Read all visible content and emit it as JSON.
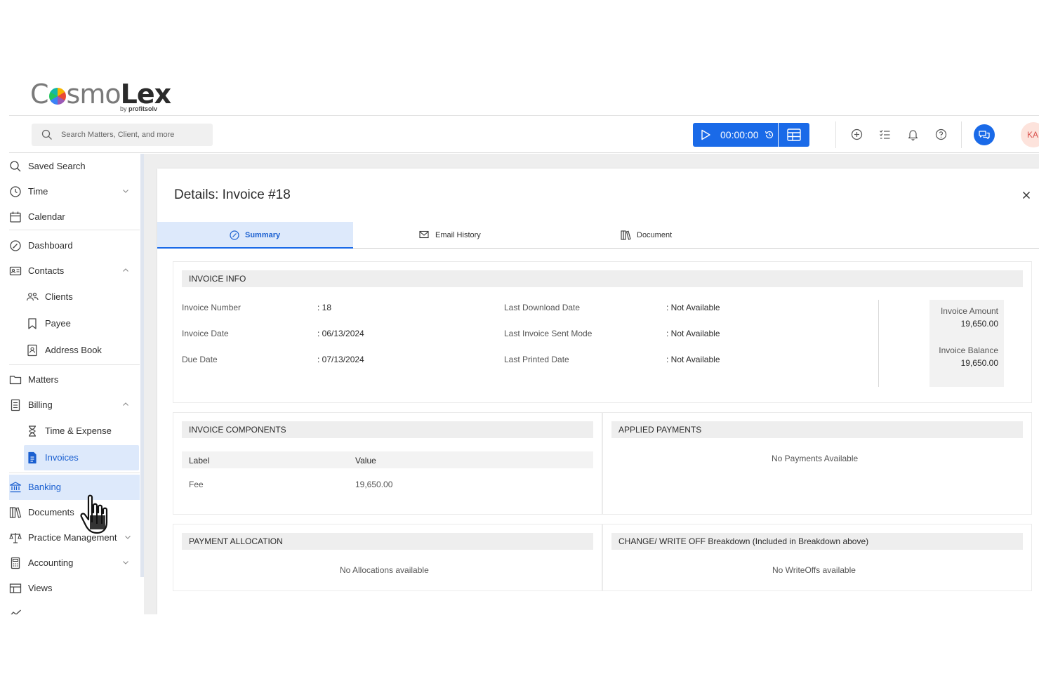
{
  "brand": {
    "logo_pre": "C",
    "logo_mid": "smo",
    "logo_bold": "Lex",
    "logo_sub_by": "by",
    "logo_sub_name": "profitsolv"
  },
  "topbar": {
    "search_placeholder": "Search Matters, Client, and more",
    "timer_value": "00:00:00",
    "avatar_initials": "KA"
  },
  "sidebar": {
    "saved_search": "Saved Search",
    "time": "Time",
    "calendar": "Calendar",
    "dashboard": "Dashboard",
    "contacts": "Contacts",
    "clients": "Clients",
    "payee": "Payee",
    "address_book": "Address Book",
    "matters": "Matters",
    "billing": "Billing",
    "time_expense": "Time & Expense",
    "invoices": "Invoices",
    "banking": "Banking",
    "documents": "Documents",
    "practice_management": "Practice Management",
    "accounting": "Accounting",
    "views": "Views"
  },
  "dialog": {
    "title": "Details: Invoice #18",
    "tabs": {
      "summary": "Summary",
      "email_history": "Email History",
      "document": "Document"
    },
    "invoice_info": {
      "header": "INVOICE INFO",
      "invoice_number_label": "Invoice Number",
      "invoice_number_value": ": 18",
      "invoice_date_label": "Invoice Date",
      "invoice_date_value": ": 06/13/2024",
      "due_date_label": "Due Date",
      "due_date_value": ": 07/13/2024",
      "last_download_label": "Last Download Date",
      "last_download_value": ": Not Available",
      "last_sent_mode_label": "Last Invoice Sent Mode",
      "last_sent_mode_value": ": Not Available",
      "last_printed_label": "Last Printed Date",
      "last_printed_value": ": Not Available",
      "invoice_amount_label": "Invoice Amount",
      "invoice_amount_value": "19,650.00",
      "invoice_balance_label": "Invoice Balance",
      "invoice_balance_value": "19,650.00"
    },
    "invoice_components": {
      "header": "INVOICE COMPONENTS",
      "col_label": "Label",
      "col_value": "Value",
      "rows": [
        {
          "label": "Fee",
          "value": "19,650.00"
        }
      ]
    },
    "applied_payments": {
      "header": "APPLIED PAYMENTS",
      "empty": "No Payments Available"
    },
    "payment_allocation": {
      "header": "PAYMENT ALLOCATION",
      "empty": "No Allocations available"
    },
    "writeoff": {
      "header": "CHANGE/ WRITE OFF Breakdown (Included in Breakdown above)",
      "empty": "No WriteOffs available"
    }
  },
  "colors": {
    "accent": "#1a6ae8",
    "active_bg": "#dde9fb"
  }
}
